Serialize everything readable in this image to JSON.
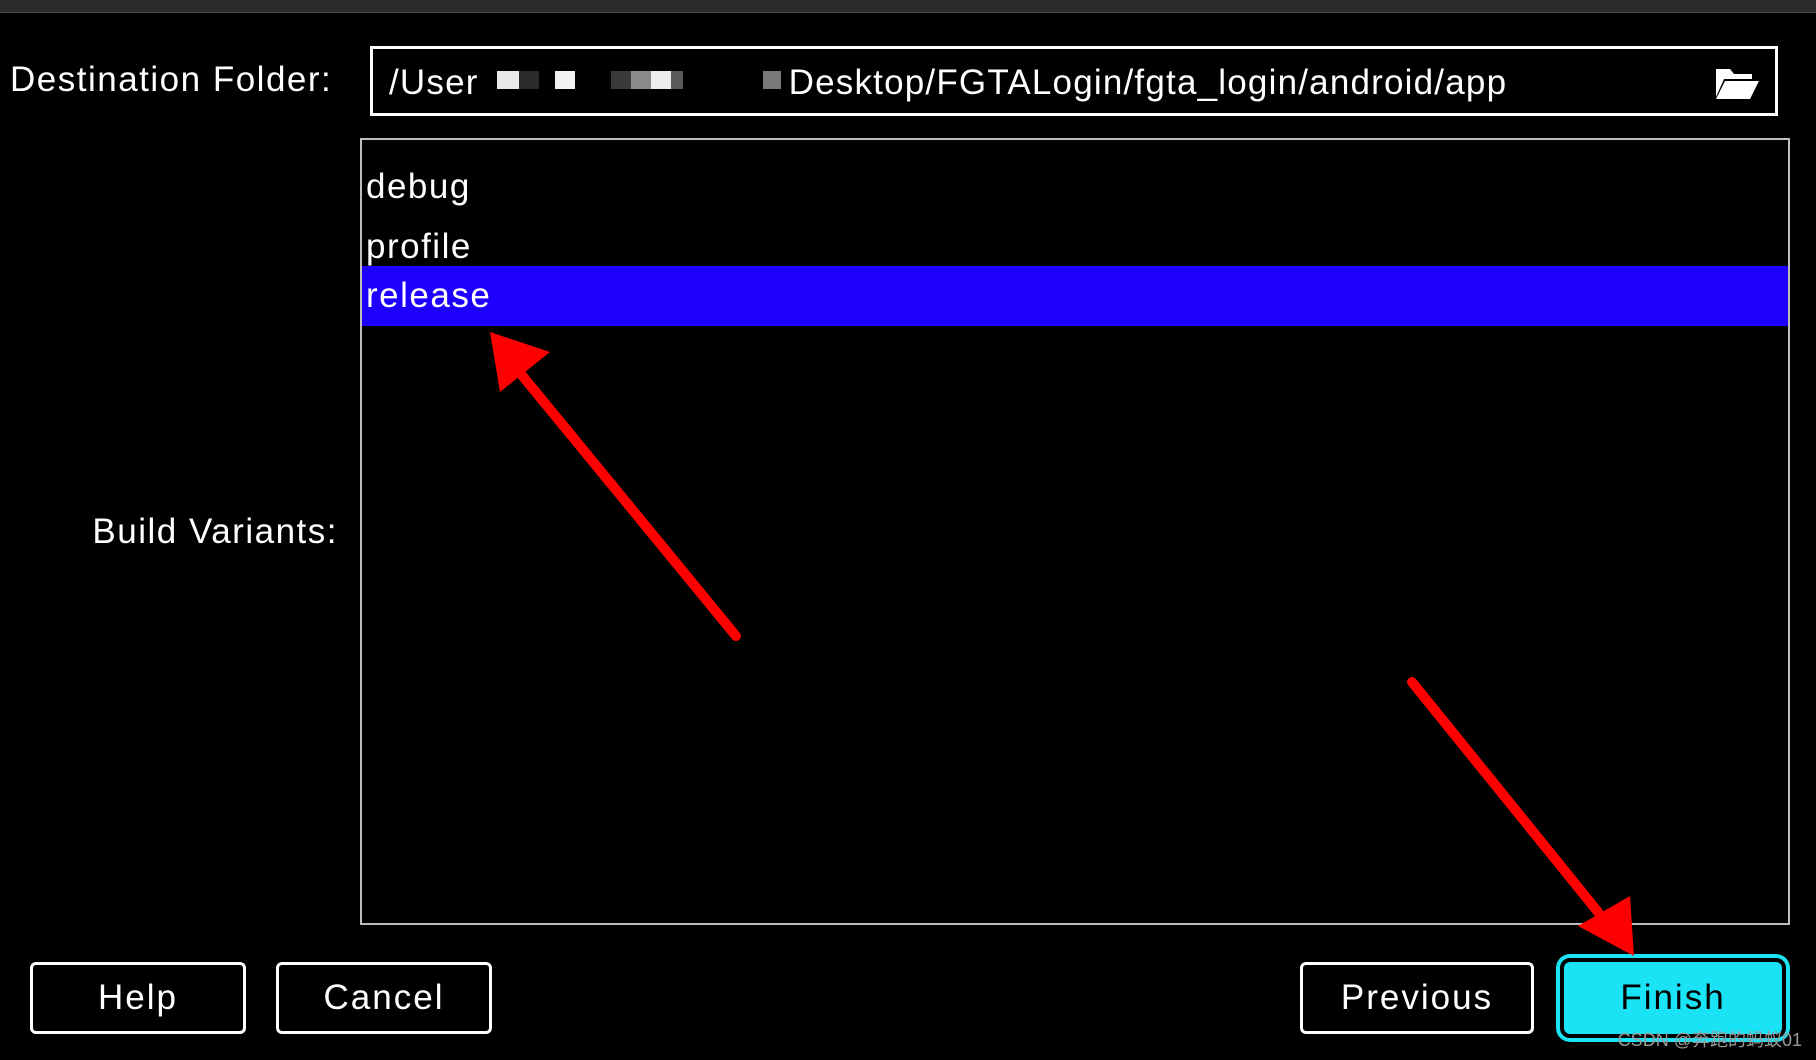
{
  "destination": {
    "label": "Destination Folder:",
    "path_prefix": "/User",
    "path_suffix": "Desktop/FGTALogin/fgta_login/android/app"
  },
  "build_variants": {
    "label": "Build Variants:",
    "items": [
      {
        "label": "debug",
        "selected": false
      },
      {
        "label": "profile",
        "selected": false
      },
      {
        "label": "release",
        "selected": true
      }
    ]
  },
  "buttons": {
    "help": "Help",
    "cancel": "Cancel",
    "previous": "Previous",
    "finish": "Finish"
  },
  "watermark": "CSDN @奔跑的蚂蚁01",
  "icons": {
    "browse": "folder-open-icon"
  },
  "colors": {
    "background": "#000000",
    "selection": "#1e00ff",
    "finish_button": "#19e3f5",
    "annotation_arrow": "#ff0000"
  }
}
